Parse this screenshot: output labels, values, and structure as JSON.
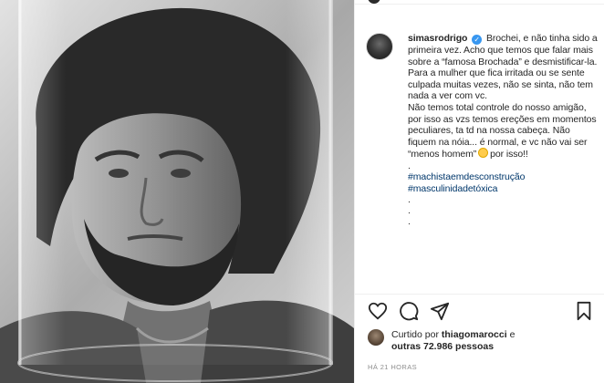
{
  "post": {
    "username": "simasrodrigo",
    "caption_p1": "Brochei, e não tinha sido a primeira vez. Acho que temos que falar mais sobre a “famosa Brochada” e desmistificar-la.",
    "caption_p2": "Para a mulher que fica irritada ou se sente culpada muitas vezes, não se sinta, não tem nada a ver com vc.",
    "caption_p3a": "Não temos total controle do nosso amigão, por isso as vzs temos ereções em momentos peculiares, ta td na nossa cabeça. Não fiquem na nóia... é normal, e vc não vai ser “menos homem”",
    "caption_p3b": "por isso!!",
    "dot": ".",
    "hashtags": [
      "#machistaemdesconstrução",
      "#masculinidadetóxica"
    ],
    "likes_prefix": "Curtido por",
    "likes_user": "thiagomarocci",
    "likes_join": "e",
    "likes_others": "outras 72.986 pessoas",
    "timestamp": "HÁ 21 HORAS"
  },
  "icons": {
    "verified": "verified-badge-icon",
    "like": "heart-icon",
    "comment": "comment-icon",
    "share": "paper-plane-icon",
    "save": "bookmark-icon",
    "emoji": "flushed-face-emoji"
  },
  "colors": {
    "verified": "#3897f0",
    "hashtag": "#00376b",
    "meta": "#8e8e8e"
  }
}
